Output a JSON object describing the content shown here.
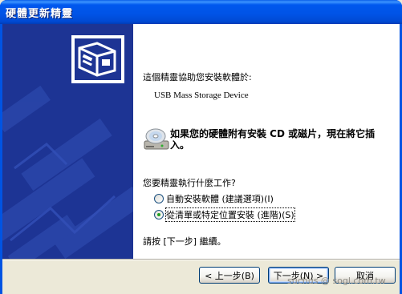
{
  "window": {
    "title": "硬體更新精靈"
  },
  "content": {
    "intro": "這個精靈協助您安裝軟體於:",
    "device_name": "USB Mass Storage Device",
    "cd_prompt": "如果您的硬體附有安裝 CD 或磁片，現在將它插入。",
    "question": "您要精靈執行什麼工作?",
    "options": [
      {
        "label": "自動安裝軟體 (建議選項)(I)",
        "selected": false
      },
      {
        "label": "從清單或特定位置安裝 (進階)(S)",
        "selected": true
      }
    ],
    "continue_hint": "請按 [下一步] 繼續。"
  },
  "buttons": {
    "back": "< 上一步(B)",
    "next": "下一步(N) >",
    "cancel": "取消"
  },
  "watermark": "suchus  @ sogl.com.tw",
  "icons": {
    "side_graphic": "hardware-device-icon",
    "cd": "cd-drive-icon"
  },
  "colors": {
    "titlebar": "#0054e3",
    "side_panel": "#1d3494",
    "radio_selected": "#21a121"
  }
}
